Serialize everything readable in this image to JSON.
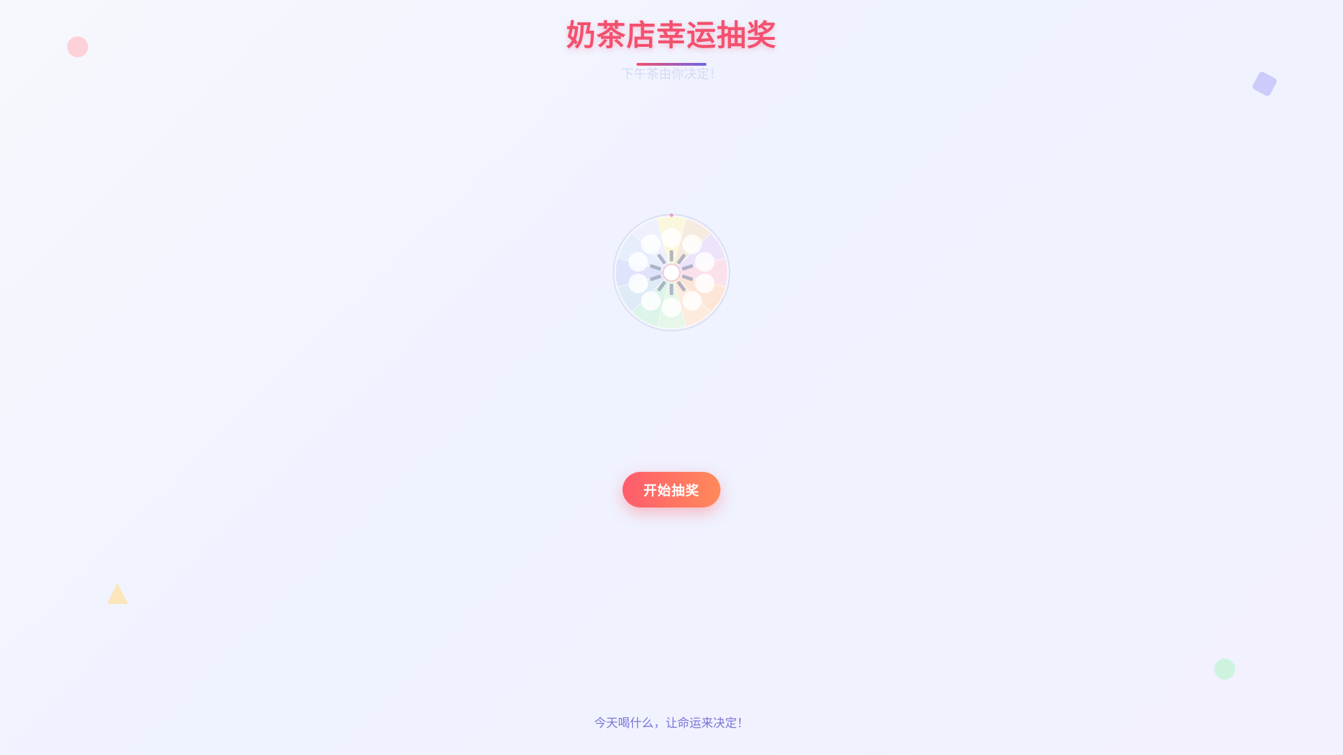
{
  "header": {
    "title": "奶茶店幸运抽奖",
    "subtitle": "下午茶由你决定！"
  },
  "wheel": {
    "segment_colors": [
      "#fbf7dc",
      "#f5ecdf",
      "#ede4fb",
      "#fbe1ec",
      "#fde6d8",
      "#fdebdd",
      "#e6f6e8",
      "#dcf4ea",
      "#e0ebf8",
      "#dfe3fb",
      "#e6eefb",
      "#eef1fb"
    ],
    "pointer_color": "#f4506f"
  },
  "controls": {
    "start_label": "开始抽奖"
  },
  "footer": {
    "text": "今天喝什么，让命运来决定！"
  },
  "colors": {
    "title": "#f4506f",
    "underline_start": "#f4506f",
    "underline_end": "#6f63e6",
    "button_start": "#ff5c6c",
    "button_end": "#ff8a5a",
    "footer": "#7b74d8"
  }
}
